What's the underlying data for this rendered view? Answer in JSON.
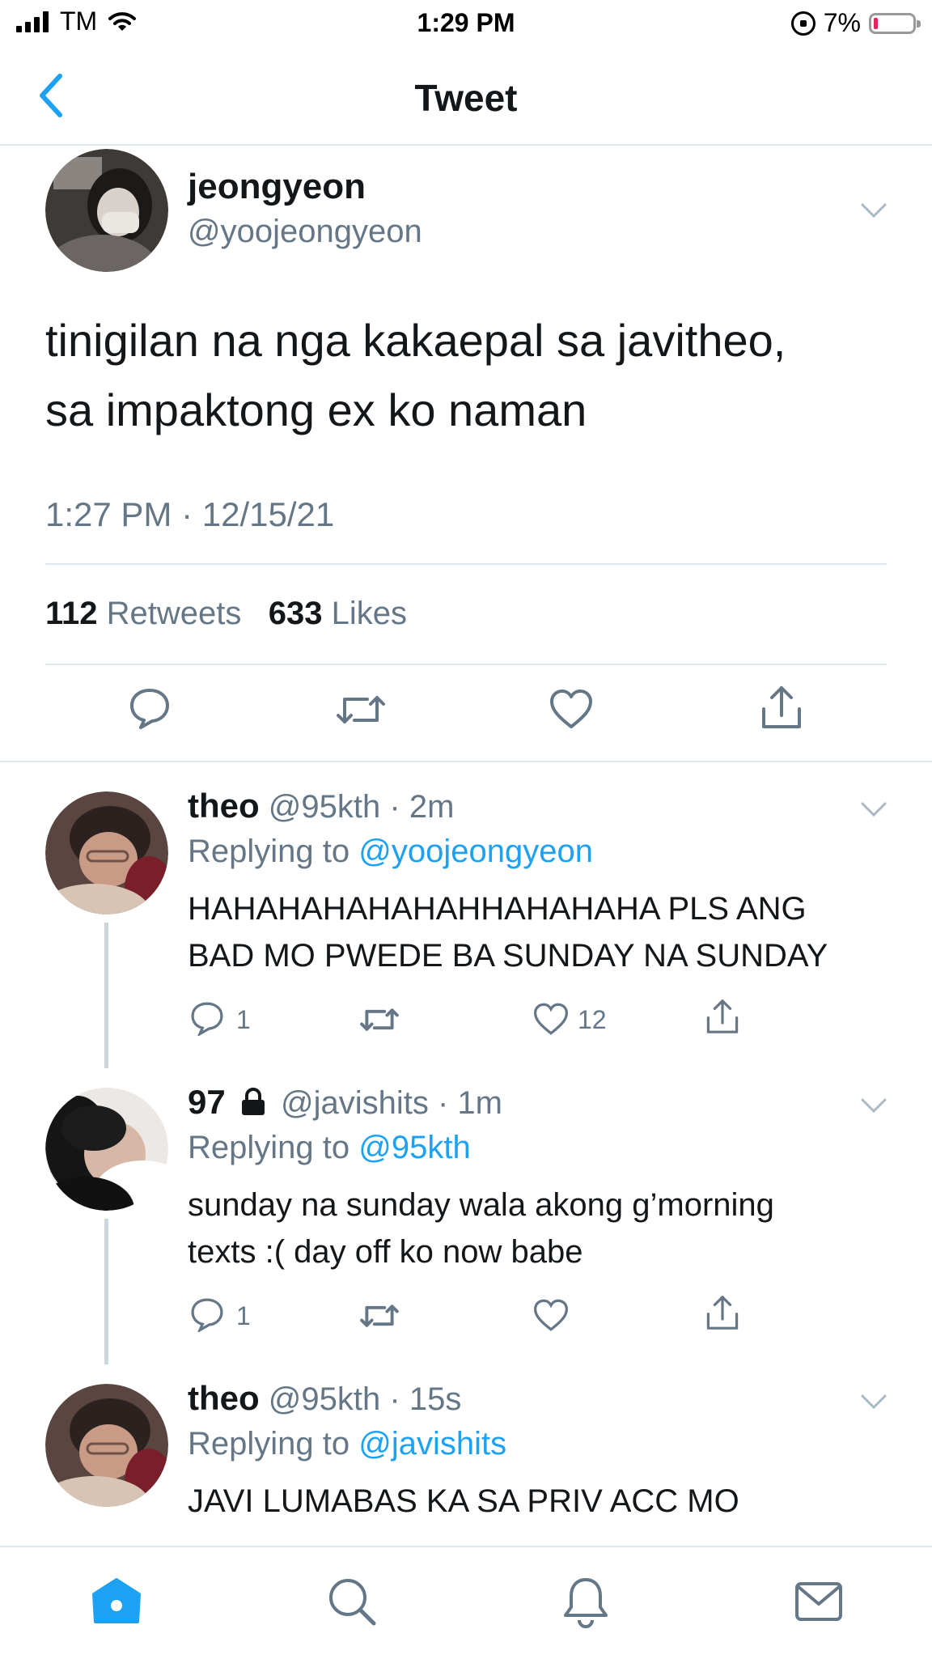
{
  "status_bar": {
    "carrier": "TM",
    "time": "1:29 PM",
    "battery_percent": "7%",
    "battery_level": 0.07,
    "low_battery_color": "#e0245e"
  },
  "nav": {
    "title": "Tweet",
    "back_icon": "chevron-left-icon",
    "accent": "#1da1f2"
  },
  "main_tweet": {
    "name": "jeongyeon",
    "handle": "@yoojeongyeon",
    "text_line1": "tinigilan na nga kakaepal sa javitheo,",
    "text_line2": "sa impaktong ex ko naman",
    "timestamp": "1:27 PM · 12/15/21",
    "retweets_count": "112",
    "retweets_label": "Retweets",
    "likes_count": "633",
    "likes_label": "Likes"
  },
  "replies": [
    {
      "name": "theo",
      "handle": "@95kth",
      "age": "2m",
      "replying_prefix": "Replying to",
      "replying_to": "@yoojeongyeon",
      "text_line1": "HAHAHAHAHAHAHHAHAHAHA PLS ANG",
      "text_line2": "BAD MO PWEDE BA SUNDAY NA SUNDAY",
      "reply_count": "1",
      "retweet_count": "",
      "like_count": "12"
    },
    {
      "name": "97",
      "handle": "@javishits",
      "age": "1m",
      "replying_prefix": "Replying to",
      "replying_to": "@95kth",
      "text_line1": "sunday na sunday wala akong g’morning",
      "text_line2": "texts :( day off ko now babe",
      "reply_count": "1",
      "retweet_count": "",
      "like_count": ""
    },
    {
      "name": "theo",
      "handle": "@95kth",
      "age": "15s",
      "replying_prefix": "Replying to",
      "replying_to": "@javishits",
      "text_line1": "JAVI LUMABAS KA SA PRIV ACC MO"
    }
  ],
  "tab_bar": {
    "items": [
      "home-icon",
      "search-icon",
      "notifications-icon",
      "messages-icon"
    ],
    "active": "home-icon"
  }
}
